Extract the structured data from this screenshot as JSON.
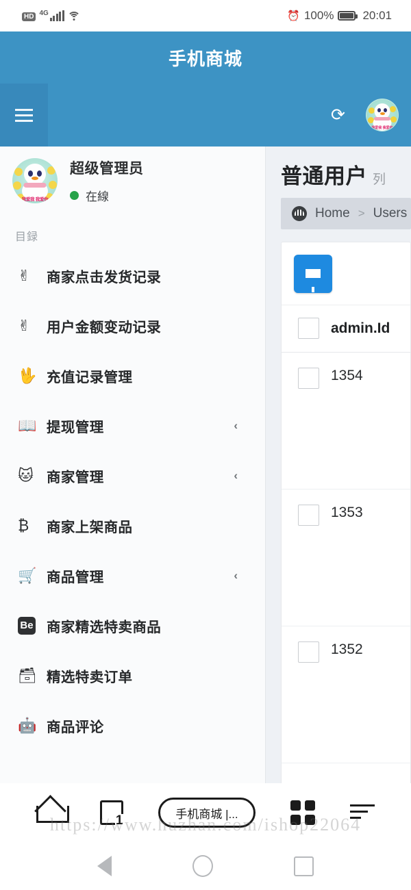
{
  "status_bar": {
    "network_badge": "HD",
    "network_type": "4G",
    "signal_icon": "signal-bars-icon",
    "wifi_icon": "wifi-icon",
    "alarm_icon": "alarm-clock-icon",
    "battery_percent": "100%",
    "battery_icon": "battery-full-icon",
    "time": "20:01"
  },
  "app_header": {
    "title": "手机商城",
    "background_color": "#3d93c4"
  },
  "toolbar": {
    "menu_icon": "hamburger-menu-icon",
    "refresh_icon": "refresh-icon",
    "avatar_icon": "user-avatar-icon"
  },
  "sidebar": {
    "profile": {
      "name": "超级管理员",
      "status": "在線",
      "status_color": "#27a349"
    },
    "section_label": "目録",
    "items": [
      {
        "label": "商家点击发货记录",
        "icon": "hand-peace-icon",
        "has_arrow": false
      },
      {
        "label": "用户金额变动记录",
        "icon": "hand-peace-icon",
        "has_arrow": false
      },
      {
        "label": "充值记录管理",
        "icon": "hand-spock-icon",
        "has_arrow": false
      },
      {
        "label": "提现管理",
        "icon": "book-open-icon",
        "has_arrow": true
      },
      {
        "label": "商家管理",
        "icon": "github-alt-icon",
        "has_arrow": true
      },
      {
        "label": "商家上架商品",
        "icon": "bitcoin-icon",
        "has_arrow": true
      },
      {
        "label": "商品管理",
        "icon": "shopping-cart-icon",
        "has_arrow": true
      },
      {
        "label": "商家精选特卖商品",
        "icon": "behance-square-icon",
        "has_arrow": false
      },
      {
        "label": "精选特卖订单",
        "icon": "archive-box-icon",
        "has_arrow": false
      },
      {
        "label": "商品评论",
        "icon": "android-icon",
        "has_arrow": false
      }
    ],
    "arrow_glyph": "‹"
  },
  "content": {
    "page_title": "普通用户",
    "page_subtitle": "列",
    "breadcrumb": {
      "dashboard_icon": "dashboard-gauge-icon",
      "items": [
        "Home",
        "Users"
      ],
      "separator": ">"
    },
    "toolbar": {
      "filter_icon": "filter-funnel-icon",
      "filter_color": "#1e8ae0"
    },
    "table": {
      "columns": [
        "",
        "admin.Id"
      ],
      "rows": [
        {
          "checkbox": false,
          "id": "1354"
        },
        {
          "checkbox": false,
          "id": "1353"
        },
        {
          "checkbox": false,
          "id": "1352"
        }
      ]
    }
  },
  "browser_bar": {
    "home_icon": "home-icon",
    "tabs_icon": "tabs-icon",
    "tabs_count": "1",
    "url_label": "手机商城 |...",
    "apps_icon": "apps-grid-icon",
    "menu_icon": "menu-lines-icon"
  },
  "watermark": "https://www.huzhan.com/ishop22064",
  "android_nav": {
    "back_icon": "back-triangle-icon",
    "home_icon": "home-circle-icon",
    "recents_icon": "recents-square-icon"
  }
}
